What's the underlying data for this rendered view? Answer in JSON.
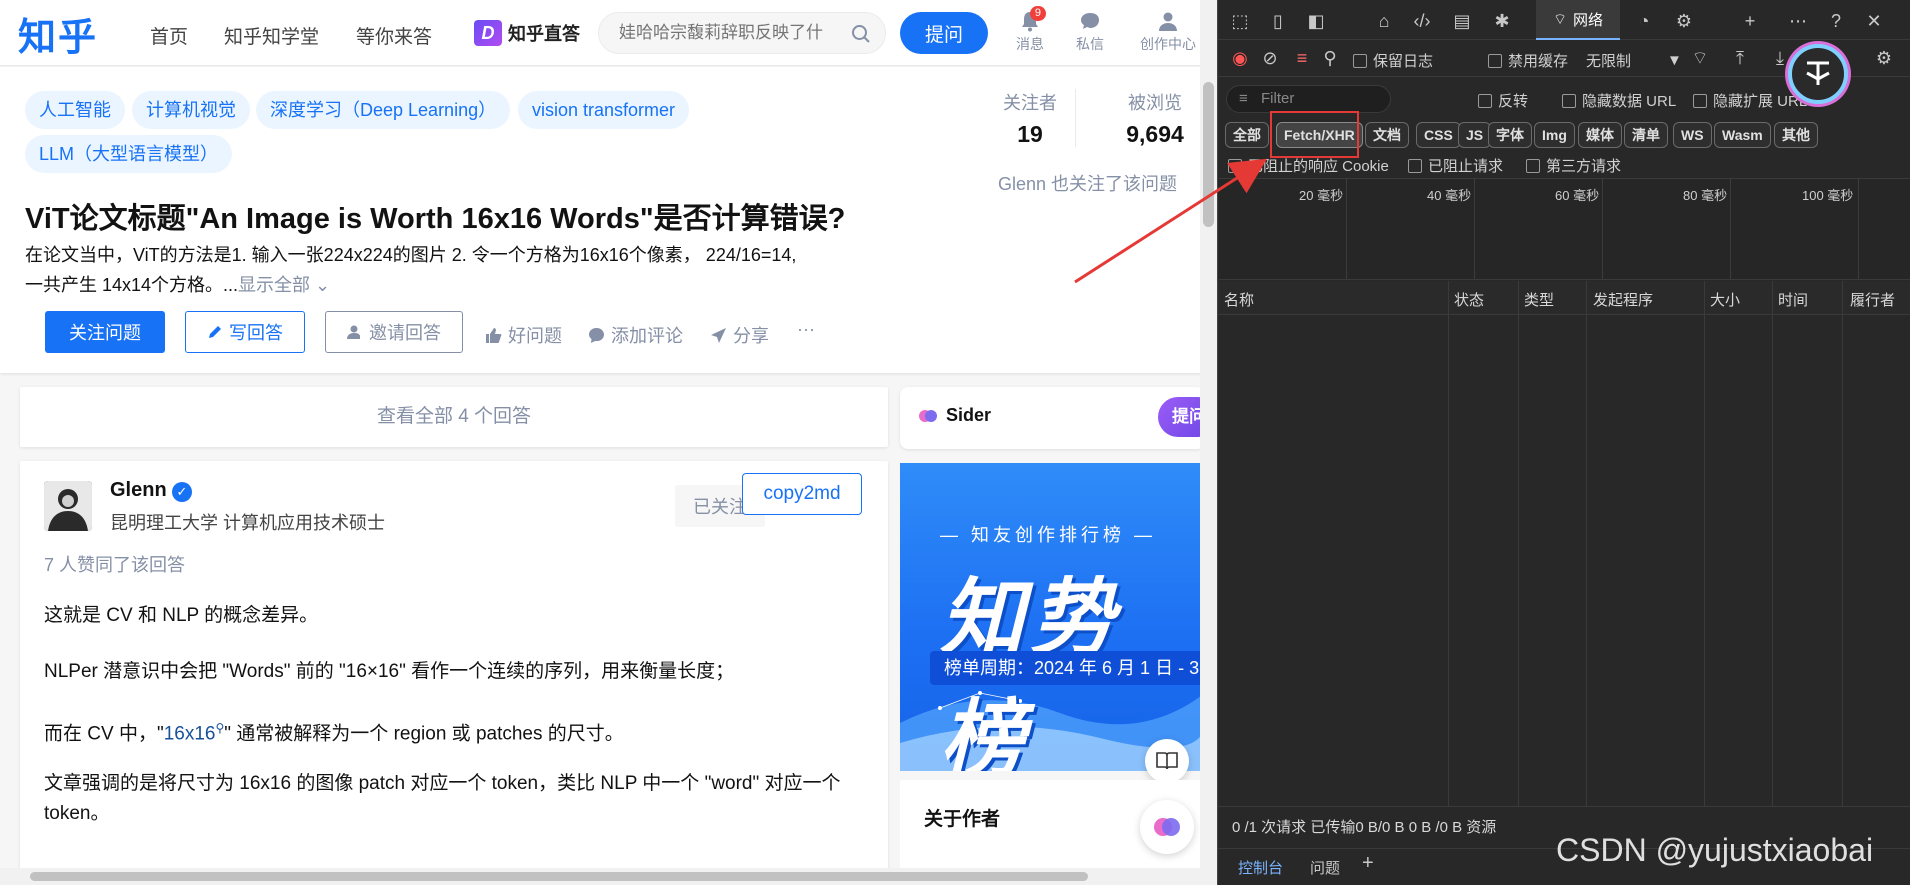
{
  "zhihu": {
    "logo": "知乎",
    "nav": [
      "首页",
      "知乎知学堂",
      "等你来答"
    ],
    "zhida": "知乎直答",
    "search_placeholder": "娃哈哈宗馥莉辞职反映了什",
    "ask_label": "提问",
    "top_icons": {
      "messages": "消息",
      "messages_badge": "9",
      "dm": "私信",
      "creator": "创作中心"
    },
    "tags": [
      "人工智能",
      "计算机视觉",
      "深度学习（Deep Learning）",
      "vision transformer",
      "LLM（大型语言模型）"
    ],
    "stats": {
      "followers_label": "关注者",
      "followers_value": "19",
      "views_label": "被浏览",
      "views_value": "9,694"
    },
    "follow_note": "Glenn 也关注了该问题",
    "question_title": "ViT论文标题\"An Image is Worth 16x16 Words\"是否计算错误?",
    "question_desc_line1": "在论文当中，ViT的方法是1. 输入一张224x224的图片 2. 令一个方格为16x16个像素， 224/16=14,",
    "question_desc_line2": "一共产生 14x14个方格。...",
    "show_all": "显示全部",
    "actions": {
      "follow": "关注问题",
      "write": "写回答",
      "invite": "邀请回答",
      "good": "好问题",
      "comment": "添加评论",
      "share": "分享",
      "more": "···"
    },
    "all_answers": "查看全部 4 个回答",
    "answer": {
      "author": "Glenn",
      "bio": "昆明理工大学 计算机应用技术硕士",
      "followed": "已关注",
      "copy2md": "copy2md",
      "votes": "7 人赞同了该回答",
      "p1": "这就是 CV 和 NLP 的概念差异。",
      "p2": "NLPer 潜意识中会把 \"Words\" 前的 \"16×16\" 看作一个连续的序列，用来衡量长度；",
      "p3_pre": "而在 CV 中，\"",
      "p3_link": "16x16",
      "p3_post": "\" 通常被解释为一个 region 或 patches 的尺寸。",
      "p4_line1": "文章强调的是将尺寸为 16x16 的图像 patch 对应一个 token，类比 NLP 中一个 \"word\" 对应一个",
      "p4_line2": "token。"
    },
    "sider": {
      "name": "Sider",
      "button": "提问"
    },
    "banner": {
      "subtitle": "— 知友创作排行榜 —",
      "big": "知势榜",
      "period": "榜单周期：2024 年 6 月 1 日 - 3"
    },
    "about_author": "关于作者"
  },
  "devtools": {
    "network_tab": "网络",
    "toolbar": {
      "preserve_log": "保留日志",
      "disable_cache": "禁用缓存",
      "throttle": "无限制"
    },
    "filter_placeholder": "Filter",
    "filter_opts": {
      "invert": "反转",
      "hide_data_url": "隐藏数据 URL",
      "hide_ext_url": "隐藏扩展 URL"
    },
    "types": [
      "全部",
      "Fetch/XHR",
      "文档",
      "CSS",
      "JS",
      "字体",
      "Img",
      "媒体",
      "清单",
      "WS",
      "Wasm",
      "其他"
    ],
    "blocked": {
      "blocked_cookies": "已阻止的响应 Cookie",
      "blocked_requests": "已阻止请求",
      "third_party": "第三方请求"
    },
    "timeline_labels": [
      "20 毫秒",
      "40 毫秒",
      "60 毫秒",
      "80 毫秒",
      "100 毫秒"
    ],
    "columns": [
      "名称",
      "状态",
      "类型",
      "发起程序",
      "大小",
      "时间",
      "履行者"
    ],
    "status_text": "0 /1 次请求  已传输0 B/0 B  0 B /0 B 资源",
    "drawer": {
      "console": "控制台",
      "issues": "问题"
    }
  },
  "watermark": "CSDN @yujustxiaobai",
  "colors": {
    "zhihu_blue": "#1772f6",
    "devtools_bg": "#282828",
    "highlight_red": "#e53935"
  }
}
